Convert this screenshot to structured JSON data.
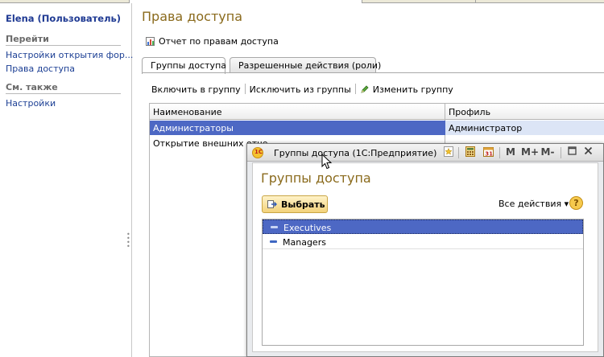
{
  "sidebar": {
    "user": "Elena (Пользователь)",
    "goto_header": "Перейти",
    "goto_items": [
      "Настройки открытия фор...",
      "Права доступа"
    ],
    "see_also_header": "См. также",
    "see_also_items": [
      "Настройки"
    ]
  },
  "main": {
    "title": "Права доступа",
    "report_link": "Отчет по правам доступа",
    "tabs": [
      {
        "label": "Группы доступа",
        "active": true
      },
      {
        "label": "Разрешенные действия (роли)",
        "active": false
      }
    ],
    "commands": {
      "include": "Включить в группу",
      "exclude": "Исключить из группы",
      "edit": "Изменить группу"
    },
    "table": {
      "columns": [
        "Наименование",
        "Профиль"
      ],
      "rows": [
        {
          "name": "Администраторы",
          "profile": "Администратор",
          "selected": true
        },
        {
          "name": "Открытие внешних отче",
          "profile": "",
          "selected": false
        }
      ]
    }
  },
  "dialog": {
    "window_title": "Группы доступа  (1С:Предприятие)",
    "logo_text": "1С",
    "toolbar": {
      "m": "M",
      "m_plus": "M+",
      "m_minus": "M-"
    },
    "heading": "Группы доступа",
    "choose_button": "Выбрать",
    "all_actions": "Все действия ▾",
    "help": "?",
    "calendar_day": "31",
    "items": [
      {
        "label": "Executives",
        "selected": true
      },
      {
        "label": "Managers",
        "selected": false
      }
    ]
  },
  "colors": {
    "accent_title": "#8a6a1c",
    "link": "#1c3f94",
    "selection": "#4d68c4"
  }
}
